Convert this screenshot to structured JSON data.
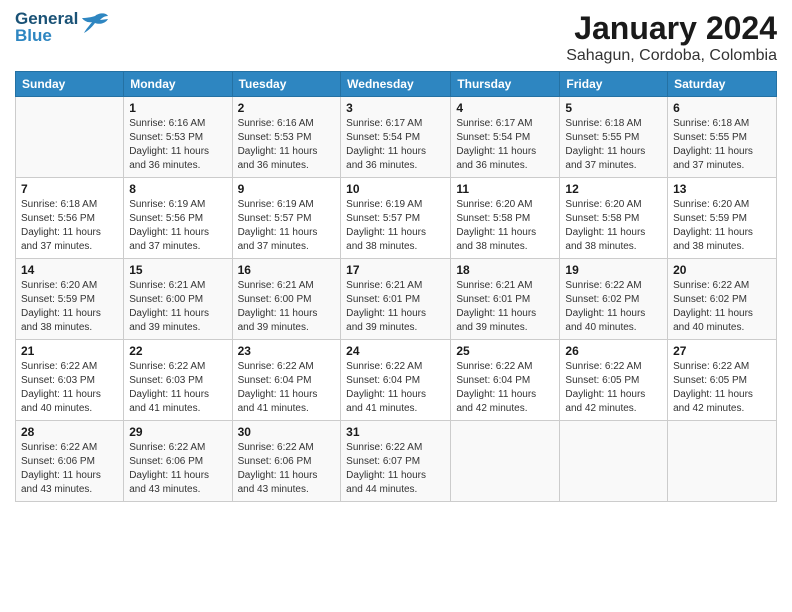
{
  "logo": {
    "line1": "General",
    "line2": "Blue"
  },
  "title": "January 2024",
  "subtitle": "Sahagun, Cordoba, Colombia",
  "header_color": "#2e86c1",
  "days_of_week": [
    "Sunday",
    "Monday",
    "Tuesday",
    "Wednesday",
    "Thursday",
    "Friday",
    "Saturday"
  ],
  "weeks": [
    [
      {
        "day": "",
        "info": ""
      },
      {
        "day": "1",
        "info": "Sunrise: 6:16 AM\nSunset: 5:53 PM\nDaylight: 11 hours and 36 minutes."
      },
      {
        "day": "2",
        "info": "Sunrise: 6:16 AM\nSunset: 5:53 PM\nDaylight: 11 hours and 36 minutes."
      },
      {
        "day": "3",
        "info": "Sunrise: 6:17 AM\nSunset: 5:54 PM\nDaylight: 11 hours and 36 minutes."
      },
      {
        "day": "4",
        "info": "Sunrise: 6:17 AM\nSunset: 5:54 PM\nDaylight: 11 hours and 36 minutes."
      },
      {
        "day": "5",
        "info": "Sunrise: 6:18 AM\nSunset: 5:55 PM\nDaylight: 11 hours and 37 minutes."
      },
      {
        "day": "6",
        "info": "Sunrise: 6:18 AM\nSunset: 5:55 PM\nDaylight: 11 hours and 37 minutes."
      }
    ],
    [
      {
        "day": "7",
        "info": "Sunrise: 6:18 AM\nSunset: 5:56 PM\nDaylight: 11 hours and 37 minutes."
      },
      {
        "day": "8",
        "info": "Sunrise: 6:19 AM\nSunset: 5:56 PM\nDaylight: 11 hours and 37 minutes."
      },
      {
        "day": "9",
        "info": "Sunrise: 6:19 AM\nSunset: 5:57 PM\nDaylight: 11 hours and 37 minutes."
      },
      {
        "day": "10",
        "info": "Sunrise: 6:19 AM\nSunset: 5:57 PM\nDaylight: 11 hours and 38 minutes."
      },
      {
        "day": "11",
        "info": "Sunrise: 6:20 AM\nSunset: 5:58 PM\nDaylight: 11 hours and 38 minutes."
      },
      {
        "day": "12",
        "info": "Sunrise: 6:20 AM\nSunset: 5:58 PM\nDaylight: 11 hours and 38 minutes."
      },
      {
        "day": "13",
        "info": "Sunrise: 6:20 AM\nSunset: 5:59 PM\nDaylight: 11 hours and 38 minutes."
      }
    ],
    [
      {
        "day": "14",
        "info": "Sunrise: 6:20 AM\nSunset: 5:59 PM\nDaylight: 11 hours and 38 minutes."
      },
      {
        "day": "15",
        "info": "Sunrise: 6:21 AM\nSunset: 6:00 PM\nDaylight: 11 hours and 39 minutes."
      },
      {
        "day": "16",
        "info": "Sunrise: 6:21 AM\nSunset: 6:00 PM\nDaylight: 11 hours and 39 minutes."
      },
      {
        "day": "17",
        "info": "Sunrise: 6:21 AM\nSunset: 6:01 PM\nDaylight: 11 hours and 39 minutes."
      },
      {
        "day": "18",
        "info": "Sunrise: 6:21 AM\nSunset: 6:01 PM\nDaylight: 11 hours and 39 minutes."
      },
      {
        "day": "19",
        "info": "Sunrise: 6:22 AM\nSunset: 6:02 PM\nDaylight: 11 hours and 40 minutes."
      },
      {
        "day": "20",
        "info": "Sunrise: 6:22 AM\nSunset: 6:02 PM\nDaylight: 11 hours and 40 minutes."
      }
    ],
    [
      {
        "day": "21",
        "info": "Sunrise: 6:22 AM\nSunset: 6:03 PM\nDaylight: 11 hours and 40 minutes."
      },
      {
        "day": "22",
        "info": "Sunrise: 6:22 AM\nSunset: 6:03 PM\nDaylight: 11 hours and 41 minutes."
      },
      {
        "day": "23",
        "info": "Sunrise: 6:22 AM\nSunset: 6:04 PM\nDaylight: 11 hours and 41 minutes."
      },
      {
        "day": "24",
        "info": "Sunrise: 6:22 AM\nSunset: 6:04 PM\nDaylight: 11 hours and 41 minutes."
      },
      {
        "day": "25",
        "info": "Sunrise: 6:22 AM\nSunset: 6:04 PM\nDaylight: 11 hours and 42 minutes."
      },
      {
        "day": "26",
        "info": "Sunrise: 6:22 AM\nSunset: 6:05 PM\nDaylight: 11 hours and 42 minutes."
      },
      {
        "day": "27",
        "info": "Sunrise: 6:22 AM\nSunset: 6:05 PM\nDaylight: 11 hours and 42 minutes."
      }
    ],
    [
      {
        "day": "28",
        "info": "Sunrise: 6:22 AM\nSunset: 6:06 PM\nDaylight: 11 hours and 43 minutes."
      },
      {
        "day": "29",
        "info": "Sunrise: 6:22 AM\nSunset: 6:06 PM\nDaylight: 11 hours and 43 minutes."
      },
      {
        "day": "30",
        "info": "Sunrise: 6:22 AM\nSunset: 6:06 PM\nDaylight: 11 hours and 43 minutes."
      },
      {
        "day": "31",
        "info": "Sunrise: 6:22 AM\nSunset: 6:07 PM\nDaylight: 11 hours and 44 minutes."
      },
      {
        "day": "",
        "info": ""
      },
      {
        "day": "",
        "info": ""
      },
      {
        "day": "",
        "info": ""
      }
    ]
  ]
}
